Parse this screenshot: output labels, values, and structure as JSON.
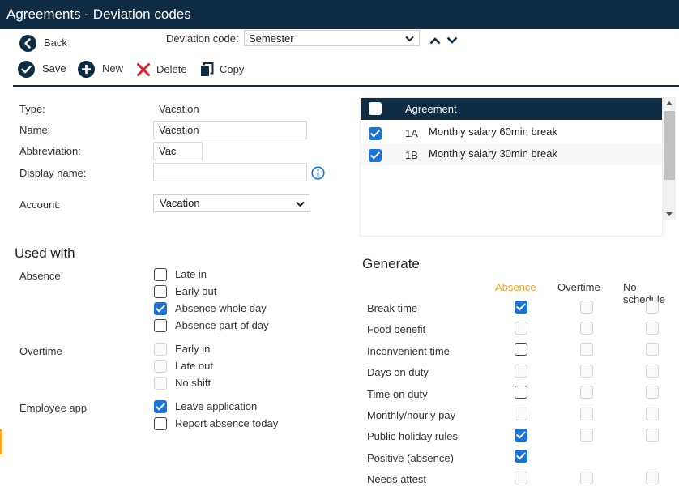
{
  "window": {
    "title": "Agreements - Deviation codes"
  },
  "toolbar": {
    "back": "Back",
    "deviation_code_label": "Deviation code:",
    "deviation_code_value": "Semester",
    "save": "Save",
    "new": "New",
    "delete": "Delete",
    "copy": "Copy"
  },
  "form": {
    "type_label": "Type:",
    "type_value": "Vacation",
    "name_label": "Name:",
    "name_value": "Vacation",
    "abbreviation_label": "Abbreviation:",
    "abbreviation_value": "Vac",
    "display_name_label": "Display name:",
    "display_name_value": "",
    "account_label": "Account:",
    "account_value": "Vacation"
  },
  "agreements": {
    "header": "Agreement",
    "rows": [
      {
        "code": "1A",
        "name": "Monthly salary 60min break",
        "checked": true
      },
      {
        "code": "1B",
        "name": "Monthly salary 30min break",
        "checked": true
      }
    ]
  },
  "used_with": {
    "title": "Used with",
    "absence_label": "Absence",
    "absence": [
      {
        "label": "Late in",
        "checked": false
      },
      {
        "label": "Early out",
        "checked": false
      },
      {
        "label": "Absence whole day",
        "checked": true
      },
      {
        "label": "Absence part of day",
        "checked": false
      }
    ],
    "overtime_label": "Overtime",
    "overtime": [
      {
        "label": "Early in",
        "checked": false
      },
      {
        "label": "Late out",
        "checked": false
      },
      {
        "label": "No shift",
        "checked": false
      }
    ],
    "employee_app_label": "Employee app",
    "employee_app": [
      {
        "label": "Leave application",
        "checked": true
      },
      {
        "label": "Report absence today",
        "checked": false
      }
    ]
  },
  "generate": {
    "title": "Generate",
    "columns": [
      "Absence",
      "Overtime",
      "No schedule"
    ],
    "rows": [
      {
        "label": "Break time"
      },
      {
        "label": "Food benefit"
      },
      {
        "label": "Inconvenient time"
      },
      {
        "label": "Days on duty"
      },
      {
        "label": "Time on duty"
      },
      {
        "label": "Monthly/hourly pay"
      },
      {
        "label": "Public holiday rules"
      },
      {
        "label": "Positive (absence)"
      },
      {
        "label": "Needs attest"
      }
    ]
  },
  "colors": {
    "accent": "#f5a623",
    "primary": "#0f2c45",
    "checkbox": "#1a73d9",
    "info": "#1a73d9",
    "delete": "#d9232e"
  }
}
